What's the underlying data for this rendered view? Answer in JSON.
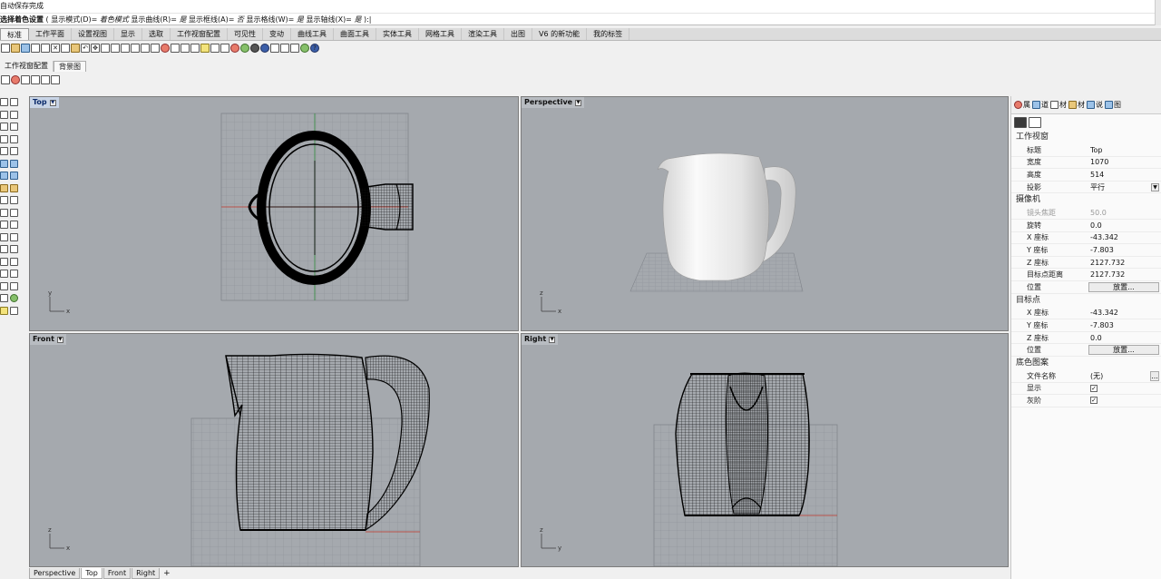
{
  "command": {
    "history": "自动保存完成",
    "prompt_cmd": "选择着色设置",
    "prompt_rest": " ( 显示模式(D)= ",
    "mode_val": "着色模式",
    "opt1": " 显示曲线(R)= ",
    "opt1_val": "是",
    "opt2": " 显示框线(A)= ",
    "opt2_val": "否",
    "opt3": " 显示格线(W)= ",
    "opt3_val": "是",
    "opt4": " 显示轴线(X)= ",
    "opt4_val": "是",
    "tail": " ):"
  },
  "tabs": [
    "标准",
    "工作平面",
    "设置视图",
    "显示",
    "选取",
    "工作视窗配置",
    "可见性",
    "变动",
    "曲线工具",
    "曲面工具",
    "实体工具",
    "网格工具",
    "渲染工具",
    "出图",
    "V6 的新功能",
    "我的标签"
  ],
  "subtabs": [
    "工作视窗配置",
    "背景图"
  ],
  "viewports": {
    "top": "Top",
    "perspective": "Perspective",
    "front": "Front",
    "right": "Right"
  },
  "axes": {
    "x": "x",
    "y": "y",
    "z": "z"
  },
  "viewport_tabs": [
    "Perspective",
    "Top",
    "Front",
    "Right"
  ],
  "viewport_tabs_add": "+",
  "panel": {
    "tabs": [
      {
        "icon": "color-icon",
        "label": "属"
      },
      {
        "icon": "layer-icon",
        "label": "道"
      },
      {
        "icon": "material-icon",
        "label": "材"
      },
      {
        "icon": "folder-icon",
        "label": "材"
      },
      {
        "icon": "help-icon",
        "label": "说"
      },
      {
        "icon": "image-icon",
        "label": "图"
      }
    ],
    "section_viewport": "工作视窗",
    "title_k": "标题",
    "title_v": "Top",
    "width_k": "宽度",
    "width_v": "1070",
    "height_k": "高度",
    "height_v": "514",
    "proj_k": "投影",
    "proj_v": "平行",
    "section_camera": "摄像机",
    "lens_k": "镜头焦距",
    "lens_v": "50.0",
    "rot_k": "旋转",
    "rot_v": "0.0",
    "cx_k": "X 座标",
    "cx_v": "-43.342",
    "cy_k": "Y 座标",
    "cy_v": "-7.803",
    "cz_k": "Z 座标",
    "cz_v": "2127.732",
    "dist_k": "目标点距离",
    "dist_v": "2127.732",
    "pos_k": "位置",
    "pos_btn": "放置...",
    "section_target": "目标点",
    "tx_k": "X 座标",
    "tx_v": "-43.342",
    "ty_k": "Y 座标",
    "ty_v": "-7.803",
    "tz_k": "Z 座标",
    "tz_v": "0.0",
    "tpos_k": "位置",
    "tpos_btn": "放置...",
    "section_bg": "底色图案",
    "file_k": "文件名称",
    "file_v": "(无)",
    "file_btn": "...",
    "show_k": "显示",
    "show_v": "✓",
    "gray_k": "灰阶",
    "gray_v": "✓"
  },
  "colors": {
    "viewport_bg": "#a5a9ae",
    "grid": "#8c9096",
    "axis_x": "#c0392b",
    "axis_y": "#2e8b3a",
    "wire": "#000000"
  }
}
